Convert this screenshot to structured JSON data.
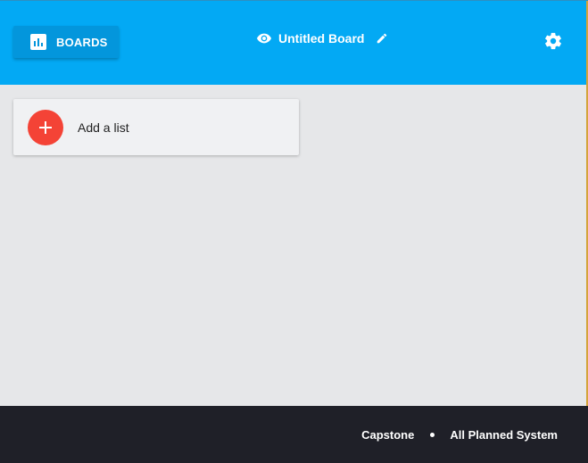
{
  "header": {
    "boards_label": "BOARDS",
    "boards_icon": "bar-chart-icon",
    "board_title": "Untitled Board",
    "visibility_icon": "eye-icon",
    "edit_icon": "pencil-icon",
    "settings_icon": "gear-icon",
    "bg_color": "#03a9f4"
  },
  "main": {
    "add_list_label": "Add a list",
    "add_icon": "plus-icon",
    "add_color": "#f44336"
  },
  "footer": {
    "left_text": "Capstone",
    "right_text": "All Planned System",
    "bg_color": "#1f2028"
  }
}
